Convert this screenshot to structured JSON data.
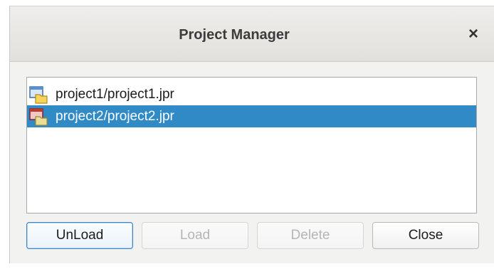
{
  "dialog": {
    "title": "Project Manager",
    "close_glyph": "×"
  },
  "projects": [
    {
      "label": "project1/project1.jpr",
      "icon": "project-icon-blue",
      "selected": false
    },
    {
      "label": "project2/project2.jpr",
      "icon": "project-icon-red",
      "selected": true
    }
  ],
  "buttons": {
    "unload": "UnLoad",
    "load": "Load",
    "delete": "Delete",
    "close": "Close"
  },
  "colors": {
    "selection": "#2f8ac6",
    "focus_border": "#3a86c4"
  }
}
